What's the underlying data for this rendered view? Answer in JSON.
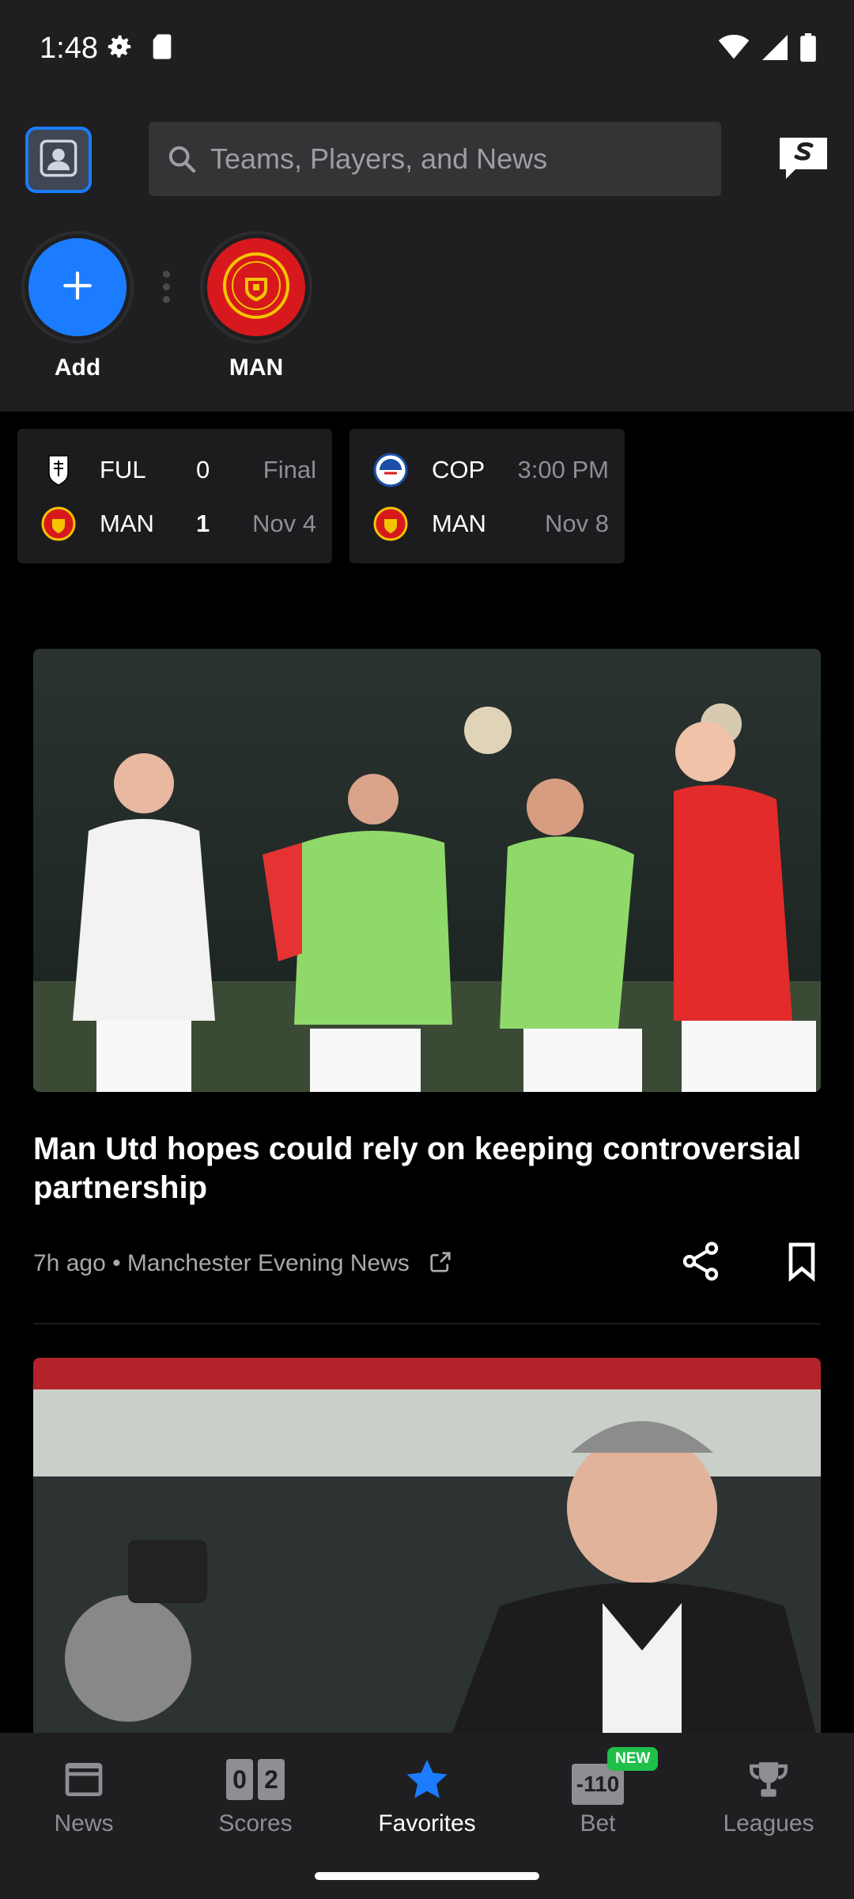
{
  "status_bar": {
    "time": "1:48"
  },
  "search": {
    "placeholder": "Teams, Players, and News"
  },
  "favorites": [
    {
      "label": "Add"
    },
    {
      "label": "MAN"
    }
  ],
  "scores": [
    {
      "rows": [
        {
          "team": "FUL",
          "score": "0",
          "status": "Final",
          "winner": false
        },
        {
          "team": "MAN",
          "score": "1",
          "status": "Nov 4",
          "winner": true
        }
      ]
    },
    {
      "rows": [
        {
          "team": "COP",
          "status": "3:00 PM"
        },
        {
          "team": "MAN",
          "status": "Nov 8"
        }
      ]
    }
  ],
  "articles": [
    {
      "headline": "Man Utd hopes could rely on keeping controversial partnership",
      "meta": "7h ago • Manchester Evening News"
    }
  ],
  "bottom_nav": [
    {
      "label": "News",
      "icon": "news-icon"
    },
    {
      "label": "Scores",
      "icon": "scores-icon",
      "icon_text": [
        "0",
        "2"
      ]
    },
    {
      "label": "Favorites",
      "icon": "star-icon",
      "active": true
    },
    {
      "label": "Bet",
      "icon": "bet-icon",
      "icon_text": "-110",
      "badge": "NEW"
    },
    {
      "label": "Leagues",
      "icon": "trophy-icon"
    }
  ],
  "colors": {
    "accent": "#1b7cff",
    "background": "#000000",
    "surface": "#1f1f21",
    "card": "#1c1c1e",
    "muted_text": "#8e8e93",
    "new_badge": "#1fbf4a",
    "man_utd_red": "#d7191d"
  }
}
